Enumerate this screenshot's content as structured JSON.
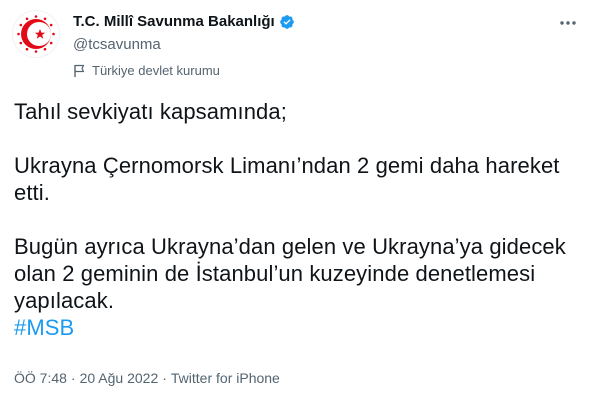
{
  "author": {
    "name": "T.C. Millî Savunma Bakanlığı",
    "handle": "@tcsavunma",
    "label": "Türkiye devlet kurumu",
    "verified_color": "#1d9bf0",
    "logo_color": "#e30a17"
  },
  "icons": {
    "verified": "verified-badge-icon",
    "label": "flag-icon",
    "more": "more-dots-icon"
  },
  "tweet": {
    "paragraphs": [
      "Tahıl sevkiyatı kapsamında;",
      "Ukrayna Çernomorsk Limanı’ndan 2 gemi daha hareket etti.",
      "Bugün ayrıca Ukrayna’dan gelen ve Ukrayna’ya gidecek olan 2 geminin de İstanbul’un kuzeyinde denetlemesi yapılacak."
    ],
    "hashtag": "#MSB"
  },
  "meta": {
    "time": "ÖÖ 7:48",
    "separator1": "·",
    "date": "20 Ağu 2022",
    "separator2": "·",
    "source": "Twitter for iPhone"
  },
  "colors": {
    "text": "#0f1419",
    "secondary": "#536471",
    "link": "#1d9bf0"
  }
}
